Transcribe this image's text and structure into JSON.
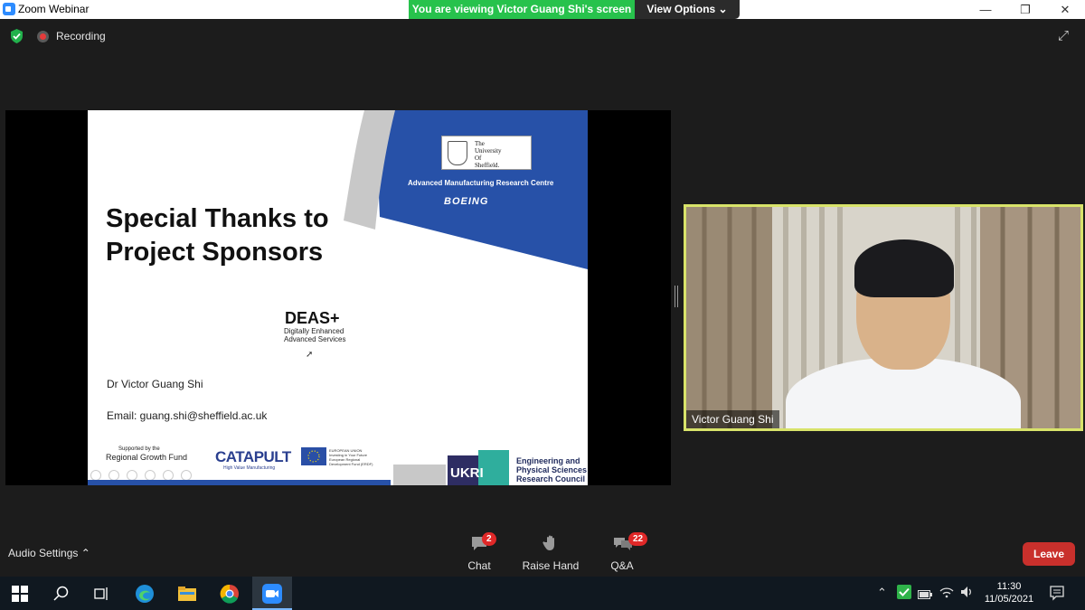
{
  "window": {
    "title": "Zoom Webinar",
    "minimize": "—",
    "restore": "❐",
    "close": "✕"
  },
  "share_banner": {
    "text": "You are viewing Victor Guang Shi's screen",
    "view_options": "View Options ⌄"
  },
  "status": {
    "recording": "Recording"
  },
  "slide": {
    "title_line1": "Special Thanks to",
    "title_line2": "Project Sponsors",
    "university_line1": "The",
    "university_line2": "University",
    "university_line3": "Of",
    "university_line4": "Sheffield.",
    "amrc": "Advanced Manufacturing Research Centre",
    "boeing": "BOEING",
    "deas_title": "DEAS+",
    "deas_sub1": "Digitally Enhanced",
    "deas_sub2": "Advanced Services",
    "name": "Dr Victor Guang Shi",
    "email": "Email: guang.shi@sheffield.ac.uk",
    "rgf_line1": "Supported by the",
    "rgf_line2": "Regional Growth Fund",
    "catapult": "CATAPULT",
    "catapult_sub": "High Value Manufacturing",
    "eu_line1": "EUROPEAN UNION",
    "eu_line2": "Investing in Your Future",
    "eu_line3": "European Regional",
    "eu_line4": "Development Fund (ERDF)",
    "ukri": "UKRI",
    "epsrc_line1": "Engineering and",
    "epsrc_line2": "Physical Sciences",
    "epsrc_line3": "Research Council"
  },
  "video": {
    "participant_name": "Victor Guang Shi"
  },
  "controls": {
    "audio_settings": "Audio Settings  ⌃",
    "chat_label": "Chat",
    "chat_badge": "2",
    "raise_hand_label": "Raise Hand",
    "qa_label": "Q&A",
    "qa_badge": "22",
    "leave_label": "Leave"
  },
  "taskbar": {
    "time": "11:30",
    "date": "11/05/2021"
  },
  "colors": {
    "share_banner": "#27c24c",
    "leave": "#c9302c",
    "slide_blue": "#2751a8",
    "video_border": "#d8e36a"
  }
}
